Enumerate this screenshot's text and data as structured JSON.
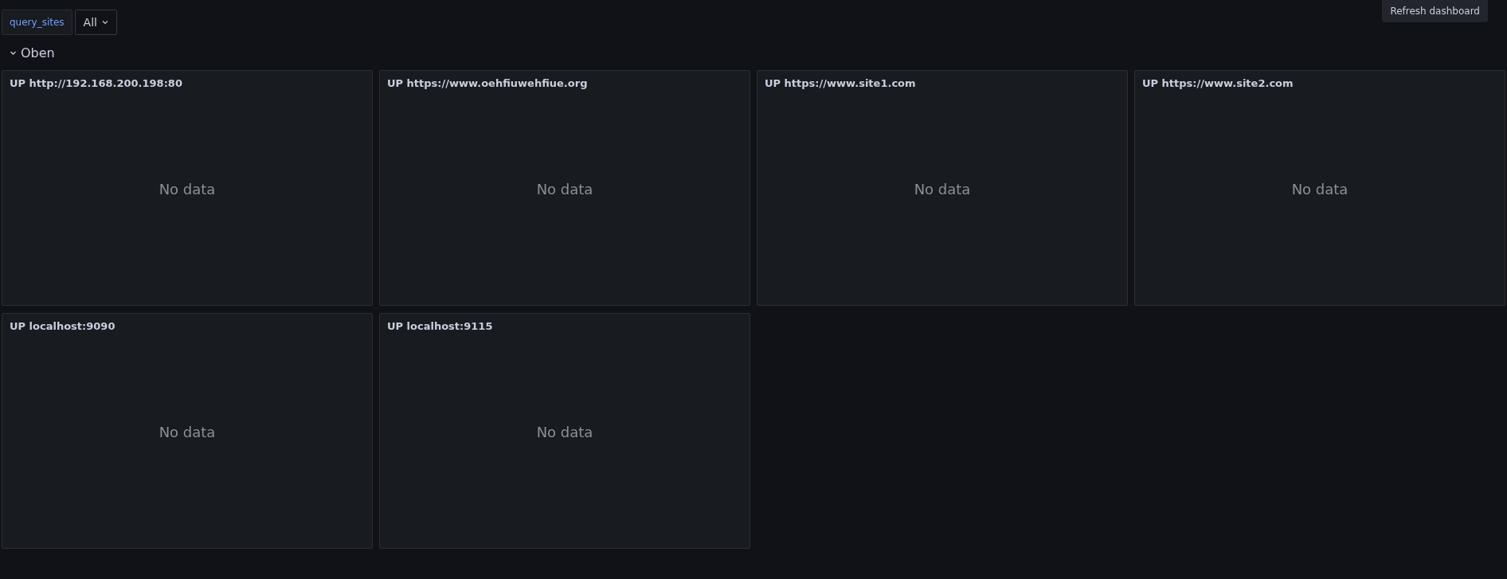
{
  "variables": [
    {
      "label": "query_sites",
      "value": "All"
    }
  ],
  "tooltip": "Refresh dashboard",
  "row": {
    "title": "Oben",
    "expanded": true
  },
  "panels": [
    {
      "title": "UP http://192.168.200.198:80",
      "message": "No data"
    },
    {
      "title": "UP https://www.oehfiuwehfiue.org",
      "message": "No data"
    },
    {
      "title": "UP https://www.site1.com",
      "message": "No data"
    },
    {
      "title": "UP https://www.site2.com",
      "message": "No data"
    },
    {
      "title": "UP localhost:9090",
      "message": "No data"
    },
    {
      "title": "UP localhost:9115",
      "message": "No data"
    }
  ]
}
